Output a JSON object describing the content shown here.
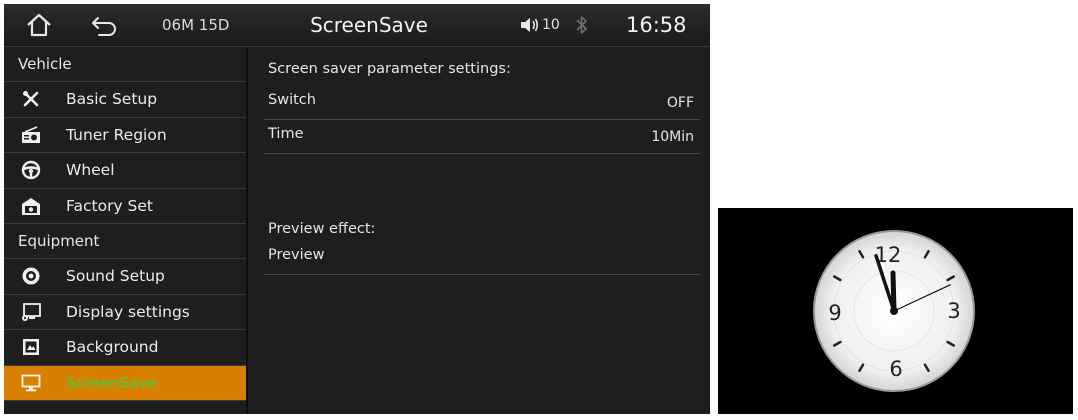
{
  "topbar": {
    "home_icon": "home-icon",
    "back_icon": "back-arrow-icon",
    "date": "06M 15D",
    "title": "ScreenSave",
    "volume_icon": "speaker-icon",
    "volume": "10",
    "bluetooth_icon": "bluetooth-icon",
    "time": "16:58"
  },
  "sidebar": {
    "sections": [
      {
        "label": "Vehicle",
        "items": [
          {
            "label": "Basic Setup",
            "icon": "tools-icon"
          },
          {
            "label": "Tuner Region",
            "icon": "radio-icon"
          },
          {
            "label": "Wheel",
            "icon": "steering-wheel-icon"
          },
          {
            "label": "Factory Set",
            "icon": "factory-icon"
          }
        ]
      },
      {
        "label": "Equipment",
        "items": [
          {
            "label": "Sound Setup",
            "icon": "speaker-circle-icon"
          },
          {
            "label": "Display settings",
            "icon": "monitor-gear-icon"
          },
          {
            "label": "Background",
            "icon": "image-icon"
          },
          {
            "label": "ScreenSave",
            "icon": "monitor-icon",
            "active": true
          }
        ]
      }
    ]
  },
  "main": {
    "heading": "Screen saver parameter settings:",
    "switch": {
      "label": "Switch",
      "value": "OFF"
    },
    "time": {
      "label": "Time",
      "value": "10Min"
    },
    "preview_heading": "Preview effect:",
    "preview_row": {
      "label": "Preview"
    }
  },
  "preview_clock": {
    "numerals": [
      "12",
      "3",
      "6",
      "9"
    ],
    "hour": 11,
    "minute": 57,
    "second": 10
  },
  "colors": {
    "active_bg": "#d97f00",
    "active_text": "#3bd04a",
    "background": "#1e1e1e"
  }
}
